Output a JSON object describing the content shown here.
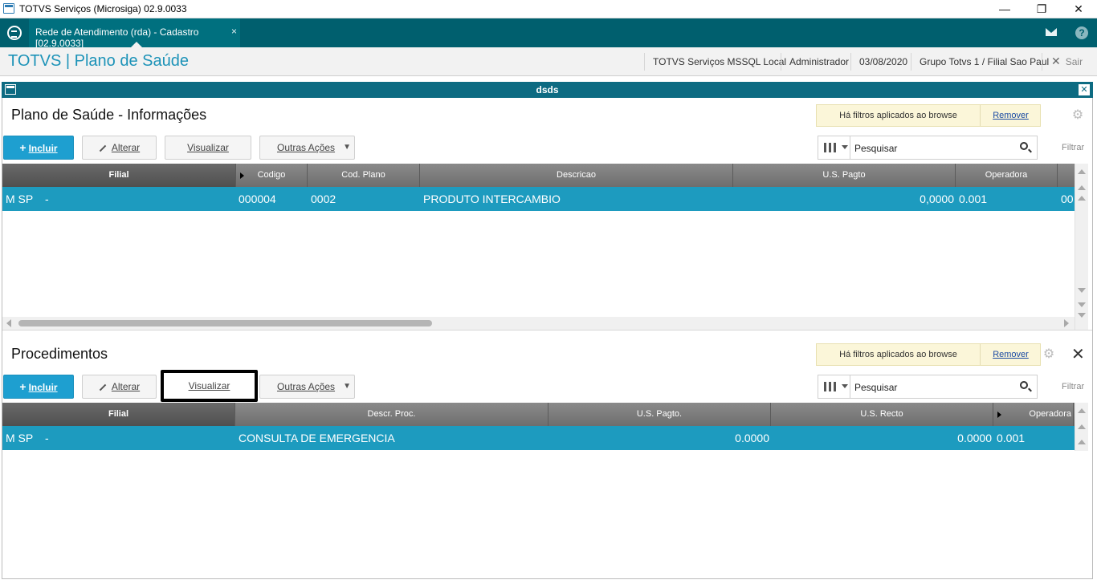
{
  "window": {
    "title": "TOTVS Serviços (Microsiga) 02.9.0033",
    "minimize": "—",
    "restore": "❐",
    "close": "✕"
  },
  "tabbar": {
    "tab_label": "Rede de Atendimento (rda) - Cadastro [02.9.0033]",
    "tab_close": "×",
    "help": "?"
  },
  "header": {
    "brand": "TOTVS | Plano de Saúde",
    "server": "TOTVS Serviços MSSQL Local",
    "user": "Administrador",
    "date": "03/08/2020",
    "company": "Grupo Totvs 1 / Filial Sao Paul",
    "exit": "Sair"
  },
  "dialog": {
    "title": "dsds"
  },
  "section1": {
    "title": "Plano de Saúde - Informações",
    "filter_msg": "Há filtros aplicados ao browse",
    "filter_remove": "Remover",
    "buttons": {
      "incluir": "Incluir",
      "alterar": "Alterar",
      "visualizar": "Visualizar",
      "outras": "Outras Ações"
    },
    "search_placeholder": "Pesquisar",
    "filtrar": "Filtrar",
    "columns": [
      "Filial",
      "Codigo",
      "Cod. Plano",
      "Descricao",
      "U.S. Pagto",
      "Operadora"
    ],
    "rows": [
      {
        "filial": "M SP",
        "dash": "-",
        "codigo": "000004",
        "cod_plano": "0002",
        "descricao": "PRODUTO INTERCAMBIO",
        "us_pagto": "0,0000",
        "operadora": "0.001",
        "extra": "00"
      }
    ]
  },
  "section2": {
    "title": "Procedimentos",
    "filter_msg": "Há filtros aplicados ao browse",
    "filter_remove": "Remover",
    "buttons": {
      "incluir": "Incluir",
      "alterar": "Alterar",
      "visualizar": "Visualizar",
      "outras": "Outras Ações"
    },
    "search_placeholder": "Pesquisar",
    "filtrar": "Filtrar",
    "columns": [
      "Filial",
      "Descr. Proc.",
      "U.S. Pagto.",
      "U.S. Recto",
      "Operadora"
    ],
    "rows": [
      {
        "filial": "M SP",
        "dash": "-",
        "descr": "CONSULTA DE EMERGENCIA",
        "us_pagto": "0.0000",
        "us_recto": "0.0000",
        "operadora": "0.001"
      }
    ]
  },
  "colors": {
    "teal_bar": "#005f6e",
    "dialog_bar": "#0d6b82",
    "row_selected": "#1d9bbf",
    "brand_text": "#1d93b8",
    "primary_button": "#1e9fd0"
  },
  "icons": [
    "app-window-icon",
    "totvs-logo-icon",
    "mail-icon",
    "help-icon",
    "gear-icon",
    "columns-icon",
    "search-icon",
    "close-icon",
    "pencil-icon",
    "plus-icon"
  ]
}
